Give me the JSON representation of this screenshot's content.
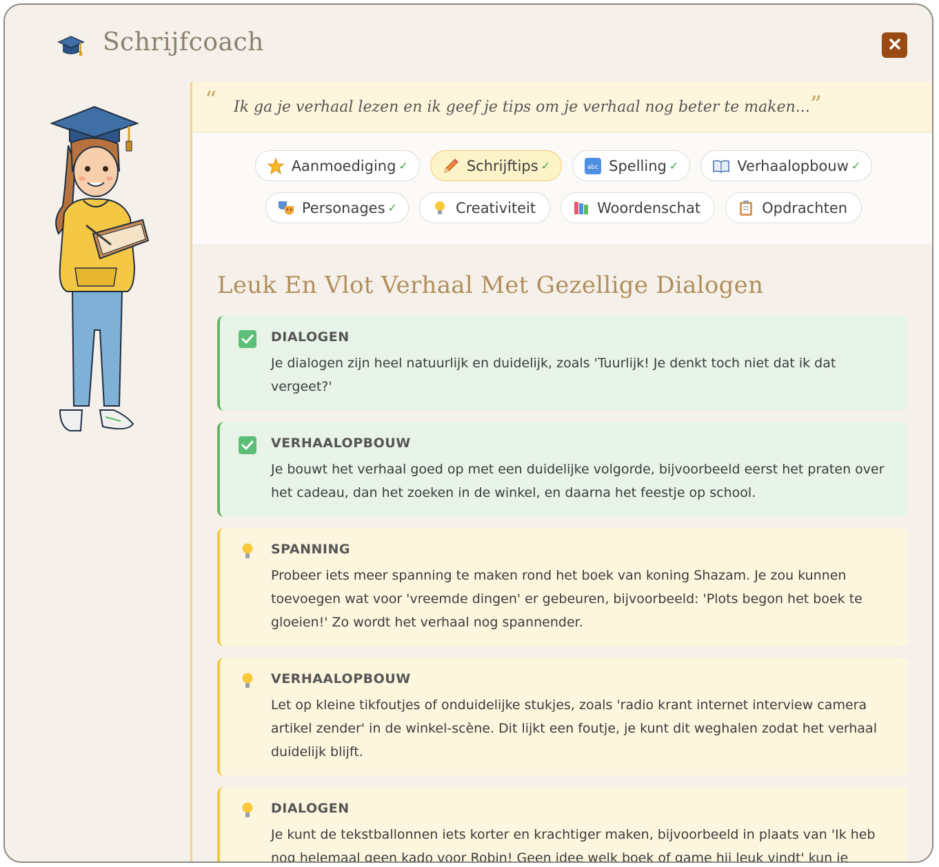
{
  "app": {
    "title": "Schrijfcoach"
  },
  "header": {
    "app_icon": "graduation-cap-icon",
    "close_icon": "close-icon"
  },
  "quote": {
    "open": "“",
    "text": "Ik ga je verhaal lezen en ik geef je tips om je verhaal nog beter te maken...",
    "close": "”"
  },
  "tabs": {
    "row1": [
      {
        "label": "Aanmoediging",
        "icon": "star-icon",
        "check": "✓",
        "active": false
      },
      {
        "label": "Schrijftips",
        "icon": "pencil-icon",
        "check": "✓",
        "active": true
      },
      {
        "label": "Spelling",
        "icon": "abc-icon",
        "check": "✓",
        "active": false
      },
      {
        "label": "Verhaalopbouw",
        "icon": "book-icon",
        "check": "✓",
        "active": false
      }
    ],
    "row2": [
      {
        "label": "Personages",
        "icon": "theater-masks-icon",
        "check": "✓",
        "active": false
      },
      {
        "label": "Creativiteit",
        "icon": "lightbulb-icon",
        "check": "",
        "active": false
      },
      {
        "label": "Woordenschat",
        "icon": "books-icon",
        "check": "",
        "active": false
      },
      {
        "label": "Opdrachten",
        "icon": "clipboard-icon",
        "check": "",
        "active": false
      }
    ]
  },
  "feedback": {
    "title": "Leuk En Vlot Verhaal Met Gezellige Dialogen",
    "cards": [
      {
        "type": "good",
        "icon": "checkmark-icon",
        "title": "DIALOGEN",
        "text": "Je dialogen zijn heel natuurlijk en duidelijk, zoals 'Tuurlijk! Je denkt toch niet dat ik dat vergeet?'"
      },
      {
        "type": "good",
        "icon": "checkmark-icon",
        "title": "VERHAALOPBOUW",
        "text": "Je bouwt het verhaal goed op met een duidelijke volgorde, bijvoorbeeld eerst het praten over het cadeau, dan het zoeken in de winkel, en daarna het feestje op school."
      },
      {
        "type": "tip",
        "icon": "lightbulb-icon",
        "title": "SPANNING",
        "text": "Probeer iets meer spanning te maken rond het boek van koning Shazam. Je zou kunnen toevoegen wat voor 'vreemde dingen' er gebeuren, bijvoorbeeld: 'Plots begon het boek te gloeien!' Zo wordt het verhaal nog spannender."
      },
      {
        "type": "tip",
        "icon": "lightbulb-icon",
        "title": "VERHAALOPBOUW",
        "text": "Let op kleine tikfoutjes of onduidelijke stukjes, zoals 'radio krant internet interview camera artikel zender' in de winkel-scène. Dit lijkt een foutje, je kunt dit weghalen zodat het verhaal duidelijk blijft."
      },
      {
        "type": "tip",
        "icon": "lightbulb-icon",
        "title": "DIALOGEN",
        "text": "Je kunt de tekstballonnen iets korter en krachtiger maken, bijvoorbeeld in plaats van 'Ik heb nog helemaal geen kado voor Robin! Geen idee welk boek of game hij leuk vindt' kun je"
      }
    ]
  }
}
